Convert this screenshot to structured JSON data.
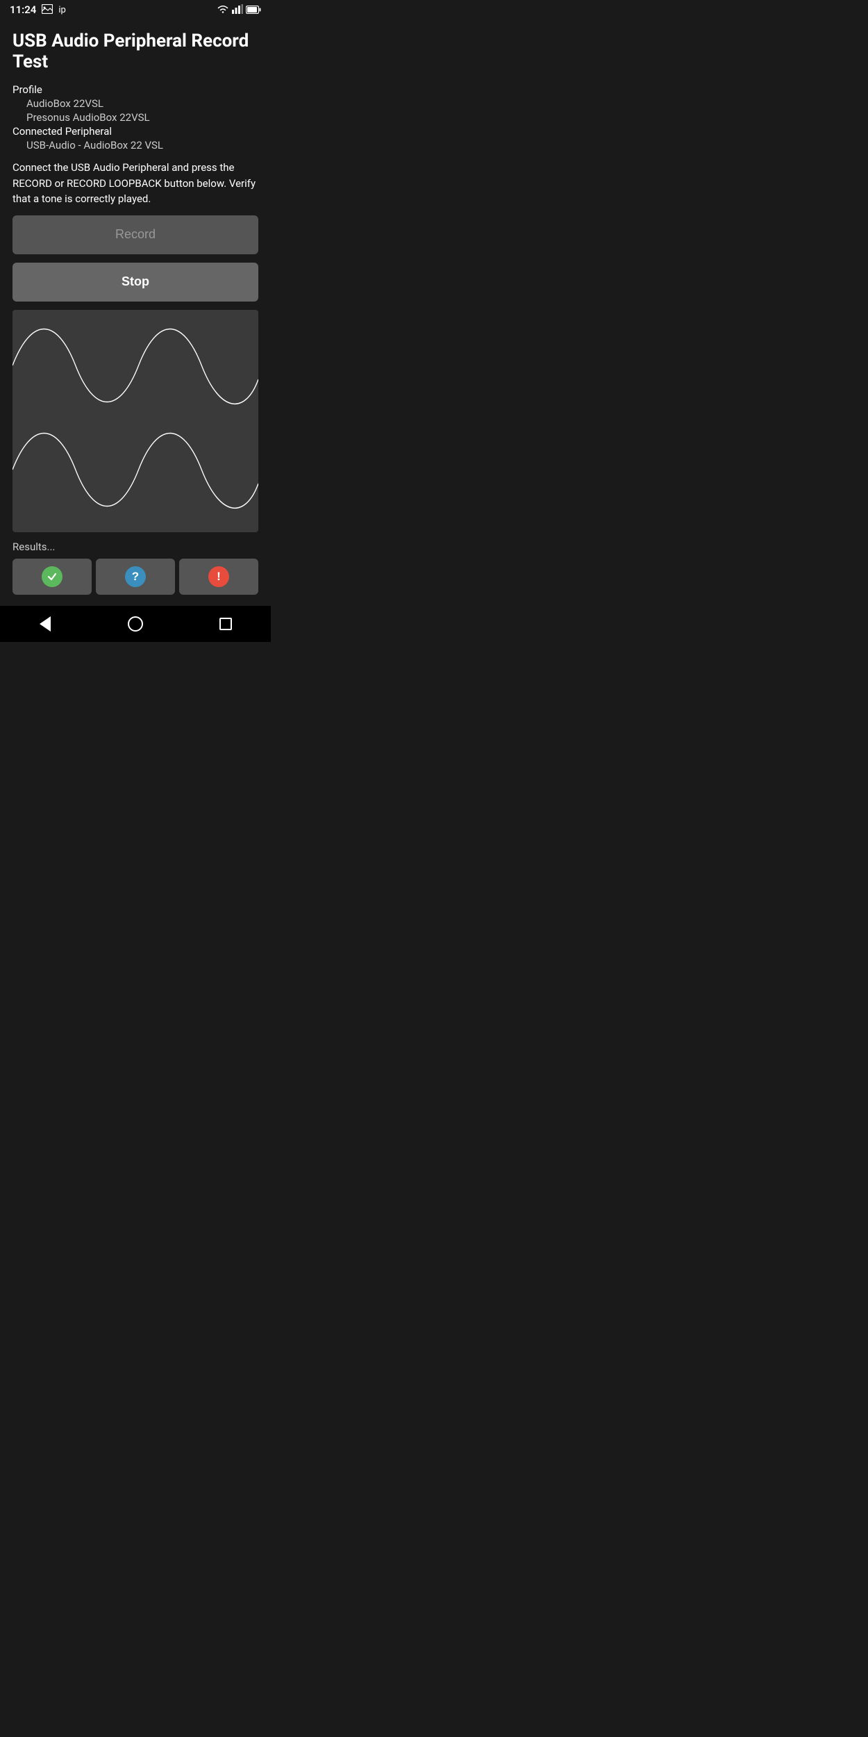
{
  "statusBar": {
    "time": "11:24",
    "leftIcons": [
      "image",
      "ip"
    ],
    "rightIcons": [
      "wifi",
      "signal",
      "battery"
    ]
  },
  "page": {
    "title": "USB Audio Peripheral Record Test",
    "profile": {
      "label": "Profile",
      "line1": "AudioBox 22VSL",
      "line2": "Presonus AudioBox 22VSL"
    },
    "connectedPeripheral": {
      "label": "Connected Peripheral",
      "value": "USB-Audio - AudioBox 22 VSL"
    },
    "instructionText": "Connect the USB Audio Peripheral and press the RECORD or RECORD LOOPBACK button below. Verify that a tone is correctly played.",
    "buttons": {
      "record": "Record",
      "stop": "Stop"
    },
    "results": {
      "label": "Results...",
      "buttons": [
        "check",
        "question",
        "exclamation"
      ]
    }
  },
  "navBar": {
    "back": "back",
    "home": "home",
    "recent": "recent"
  }
}
